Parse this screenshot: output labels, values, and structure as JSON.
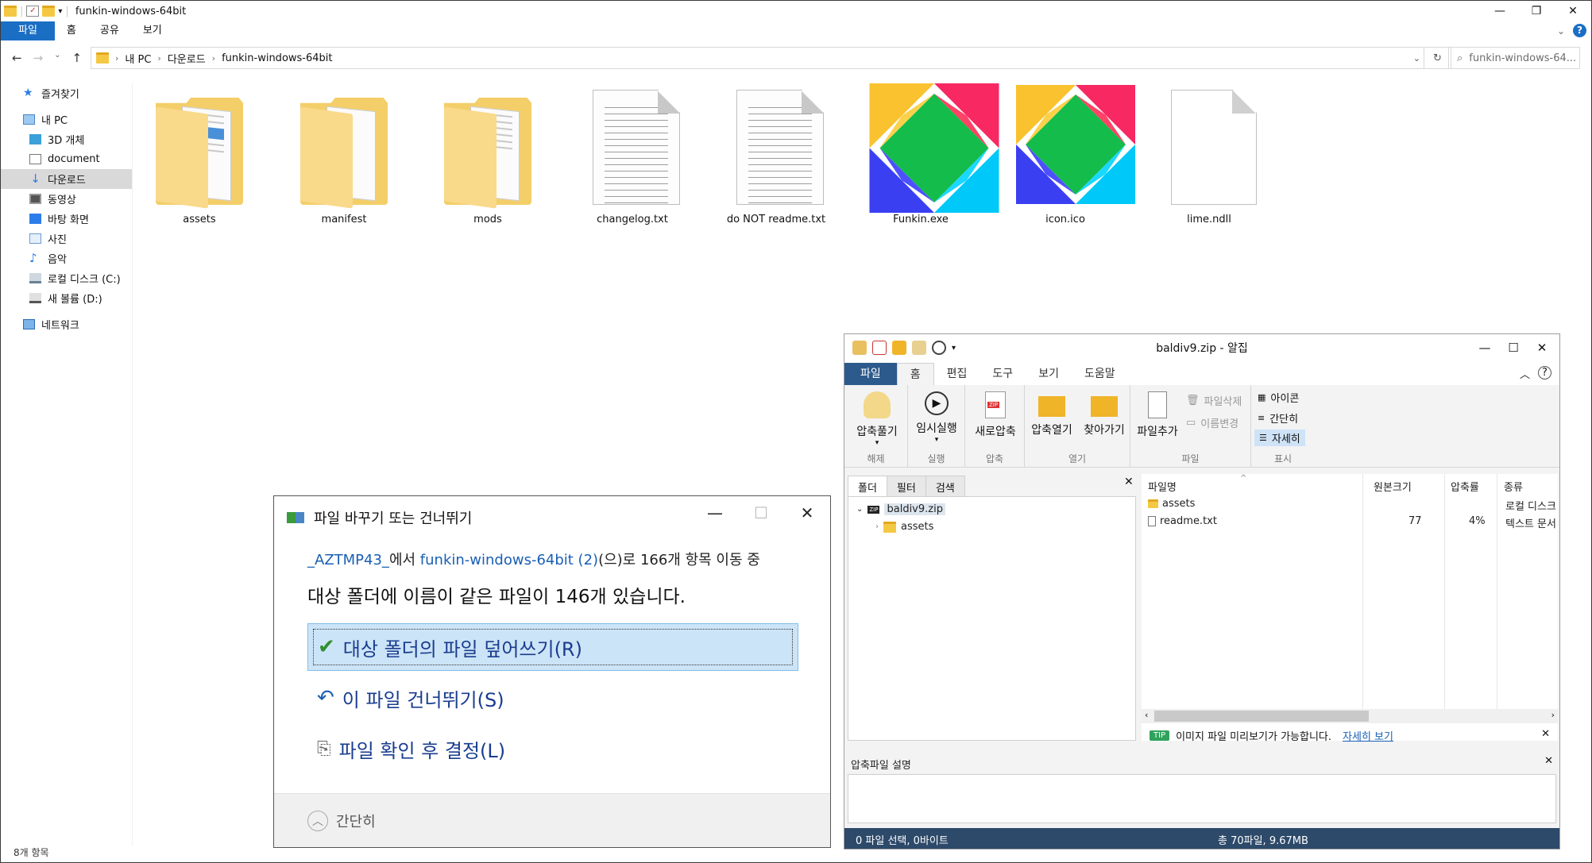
{
  "explorer": {
    "title": "funkin-windows-64bit",
    "tabs": [
      "파일",
      "홈",
      "공유",
      "보기"
    ],
    "path": [
      "내 PC",
      "다운로드",
      "funkin-windows-64bit"
    ],
    "search_placeholder": "funkin-windows-64...",
    "sidebar": {
      "quick_access": "즐겨찾기",
      "this_pc": "내 PC",
      "items": [
        "3D 개체",
        "document",
        "다운로드",
        "동영상",
        "바탕 화면",
        "사진",
        "음악",
        "로컬 디스크 (C:)",
        "새 볼륨 (D:)"
      ],
      "network": "네트워크"
    },
    "files": [
      {
        "name": "assets",
        "kind": "folder"
      },
      {
        "name": "manifest",
        "kind": "folder"
      },
      {
        "name": "mods",
        "kind": "folder"
      },
      {
        "name": "changelog.txt",
        "kind": "text"
      },
      {
        "name": "do NOT readme.txt",
        "kind": "text"
      },
      {
        "name": "Funkin.exe",
        "kind": "app-logo"
      },
      {
        "name": "icon.ico",
        "kind": "app-logo"
      },
      {
        "name": "lime.ndll",
        "kind": "blank"
      }
    ],
    "status": "8개 항목"
  },
  "dialog": {
    "title": "파일 바꾸기 또는 건너뛰기",
    "src": "_AZTMP43_",
    "src_suffix": "에서",
    "dest": "funkin-windows-64bit (2)",
    "dest_suffix": "(으)로 166개 항목 이동 중",
    "message": "대상 폴더에 이름이 같은 파일이 146개 있습니다.",
    "options": [
      "대상 폴더의 파일 덮어쓰기(R)",
      "이 파일 건너뛰기(S)",
      "파일 확인 후 결정(L)"
    ],
    "less_details": "간단히"
  },
  "alzip": {
    "title": "baldiv9.zip - 알집",
    "tabs": [
      "파일",
      "홈",
      "편집",
      "도구",
      "보기",
      "도움말"
    ],
    "ribbon": {
      "extract": "압축풀기",
      "extract_group": "해제",
      "temp_run": "임시실행",
      "run_group": "실행",
      "new_archive": "새로압축",
      "compress_group": "압축",
      "open_archive": "압축열기",
      "find": "찾아가기",
      "open_group": "열기",
      "add_file": "파일추가",
      "delete_file": "파일삭제",
      "rename": "이름변경",
      "file_group": "파일",
      "view_icon": "아이콘",
      "view_simple": "간단히",
      "view_detail": "자세히",
      "view_group": "표시"
    },
    "pane_tabs": [
      "폴더",
      "필터",
      "검색"
    ],
    "tree": {
      "root": "baldiv9.zip",
      "child": "assets"
    },
    "columns": [
      "파일명",
      "원본크기",
      "압축률",
      "종류"
    ],
    "rows": [
      {
        "name": "assets",
        "size": "",
        "ratio": "",
        "type": "로컬 디스크"
      },
      {
        "name": "readme.txt",
        "size": "77",
        "ratio": "4%",
        "type": "텍스트 문서"
      }
    ],
    "tip_badge": "TIP",
    "tip": "이미지 파일 미리보기가 가능합니다.",
    "tip_link": "자세히 보기",
    "desc_title": "압축파일 설명",
    "status_left": "0 파일 선택,  0바이트",
    "status_right": "총 70파일,  9.67MB"
  }
}
